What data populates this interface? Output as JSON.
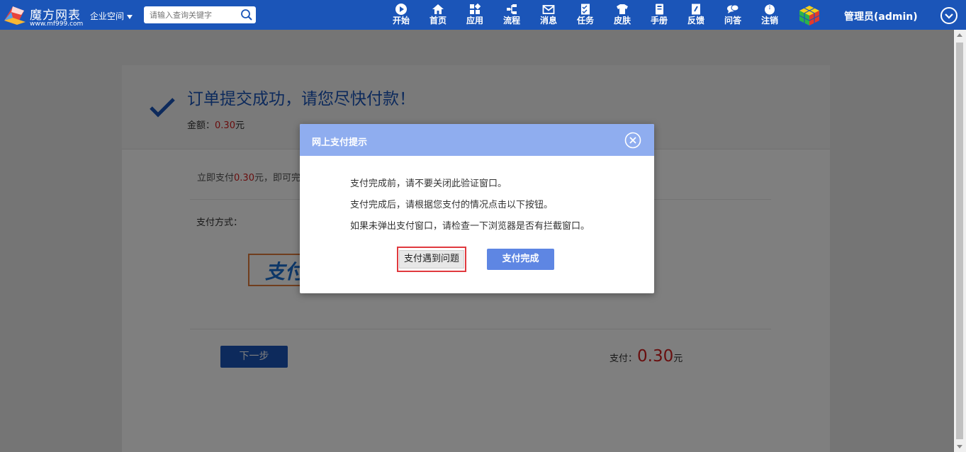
{
  "header": {
    "brand_name": "魔方网表",
    "brand_url": "www.mf999.com",
    "space_label": "企业空间",
    "search_placeholder": "请输入查询关键字",
    "nav": [
      {
        "label": "开始",
        "icon": "play-icon"
      },
      {
        "label": "首页",
        "icon": "home-icon"
      },
      {
        "label": "应用",
        "icon": "apps-icon"
      },
      {
        "label": "流程",
        "icon": "flow-icon"
      },
      {
        "label": "消息",
        "icon": "mail-icon"
      },
      {
        "label": "任务",
        "icon": "task-icon"
      },
      {
        "label": "皮肤",
        "icon": "shirt-icon"
      },
      {
        "label": "手册",
        "icon": "manual-icon"
      },
      {
        "label": "反馈",
        "icon": "feedback-icon"
      },
      {
        "label": "问答",
        "icon": "qa-icon"
      },
      {
        "label": "注销",
        "icon": "power-icon"
      }
    ],
    "user": "管理员(admin)"
  },
  "order": {
    "title": "订单提交成功，请您尽快付款！",
    "amount_label": "金额：",
    "amount_value": "0.30",
    "amount_unit": "元",
    "pay_prefix": "立即支付",
    "pay_value": "0.30",
    "pay_suffix": "元，即可完",
    "method_label": "支付方式：",
    "alipay_text": "支付",
    "next_button": "下一步",
    "total_label": "支付：",
    "total_value": "0.30",
    "total_unit": "元"
  },
  "dialog": {
    "title": "网上支付提示",
    "messages": [
      "支付完成前，请不要关闭此验证窗口。",
      "支付完成后，请根据您支付的情况点击以下按钮。",
      "如果未弹出支付窗口，请检查一下浏览器是否有拦截窗口。"
    ],
    "problem_button": "支付遇到问题",
    "done_button": "支付完成"
  },
  "colors": {
    "header_bg": "#1b55b8",
    "dialog_header_bg": "#8fadef",
    "accent": "#5e86e3",
    "price_red": "#d21d1d"
  }
}
